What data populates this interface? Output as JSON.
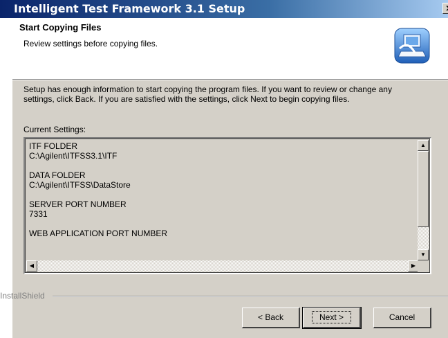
{
  "window": {
    "title": "Intelligent Test Framework 3.1 Setup",
    "close_glyph": "×"
  },
  "header": {
    "title": "Start Copying Files",
    "subtitle": "Review settings before copying files.",
    "icon": "installer-computer-icon"
  },
  "body": {
    "description": "Setup has enough information to start copying the program files.  If you want to review or change any settings, click Back.  If you are satisfied with the settings, click Next to begin copying files.",
    "current_settings_label": "Current Settings:"
  },
  "settings": {
    "text": "ITF FOLDER\nC:\\Agilent\\ITFSS3.1\\ITF\n\nDATA FOLDER\nC:\\Agilent\\ITFSS\\DataStore\n\nSERVER PORT NUMBER\n7331\n\nWEB APPLICATION PORT NUMBER"
  },
  "footer": {
    "brand": "InstallShield",
    "back_label": "< Back",
    "next_label": "Next >",
    "cancel_label": "Cancel"
  },
  "colors": {
    "title_gradient_start": "#0a246a",
    "title_gradient_end": "#a6caf0",
    "dialog_face": "#d4d0c8"
  }
}
